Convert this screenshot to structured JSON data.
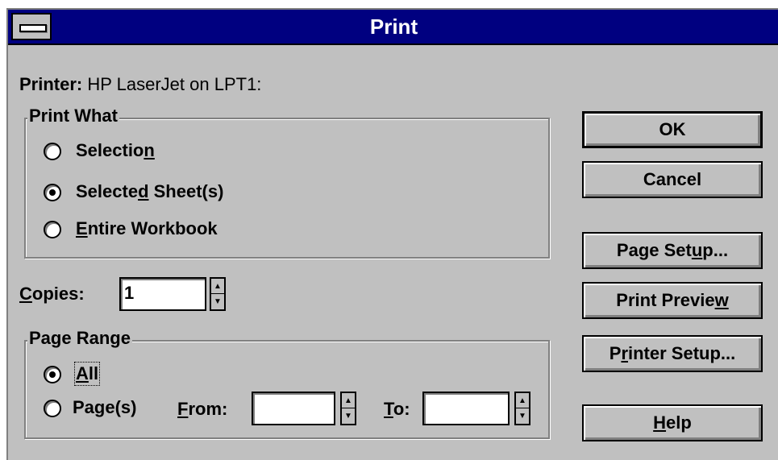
{
  "window": {
    "title": "Print"
  },
  "printer": {
    "label": "Printer:",
    "value": "HP LaserJet on LPT1:"
  },
  "print_what": {
    "legend": "Print What",
    "options": [
      {
        "pre": "Selectio",
        "mn": "n",
        "post": "",
        "selected": false
      },
      {
        "pre": "Selecte",
        "mn": "d",
        "post": " Sheet(s)",
        "selected": true
      },
      {
        "pre": "",
        "mn": "E",
        "post": "ntire Workbook",
        "selected": false
      }
    ]
  },
  "copies": {
    "mn": "C",
    "rest": "opies:",
    "value": "1"
  },
  "page_range": {
    "legend": "Page Range",
    "all": {
      "mn": "A",
      "rest": "ll",
      "selected": true
    },
    "pages": {
      "pre": "Pa",
      "mn": "g",
      "post": "e(s)",
      "selected": false
    },
    "from": {
      "mn": "F",
      "rest": "rom:",
      "value": ""
    },
    "to": {
      "mn": "T",
      "rest": "o:",
      "value": ""
    }
  },
  "buttons": {
    "ok": "OK",
    "cancel": "Cancel",
    "page_setup": {
      "pre": "Page Set",
      "mn": "u",
      "post": "p..."
    },
    "print_preview": {
      "pre": "Print Previe",
      "mn": "w",
      "post": ""
    },
    "printer_setup": {
      "pre": "P",
      "mn": "r",
      "post": "inter Setup..."
    },
    "help": {
      "pre": "",
      "mn": "H",
      "post": "elp"
    }
  }
}
